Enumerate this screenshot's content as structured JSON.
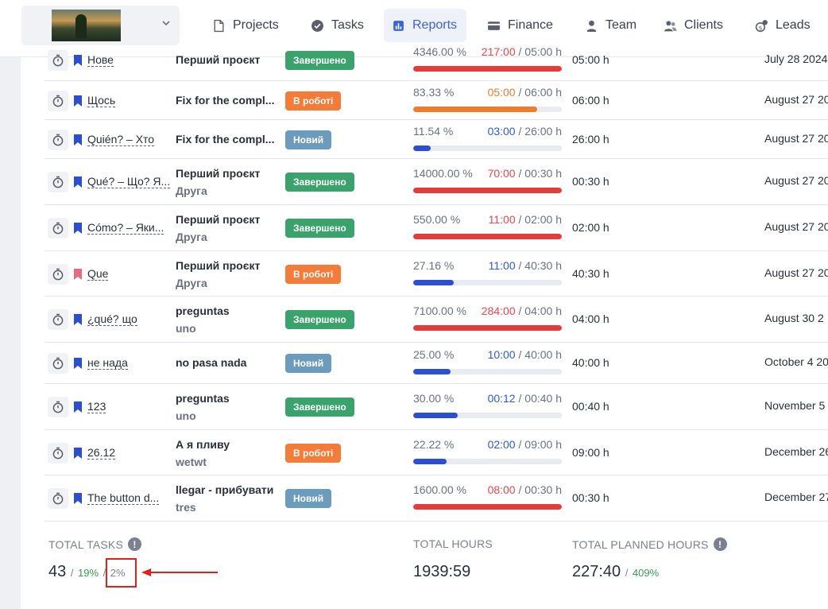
{
  "nav": {
    "items": [
      {
        "label": "Projects",
        "icon": "file-icon"
      },
      {
        "label": "Tasks",
        "icon": "check-circle-icon"
      },
      {
        "label": "Reports",
        "icon": "bar-chart-icon",
        "active": true
      },
      {
        "label": "Finance",
        "icon": "credit-card-icon"
      },
      {
        "label": "Team",
        "icon": "user-icon"
      },
      {
        "label": "Clients",
        "icon": "users-icon"
      },
      {
        "label": "Leads",
        "icon": "leads-icon"
      }
    ]
  },
  "colors": {
    "accent": "#3c63d8",
    "done": "#3aa36c",
    "in_work": "#f47b38",
    "new": "#6b9bbd",
    "over": "#e63b3b",
    "highlight": "#e0201c"
  },
  "rows": [
    {
      "name": "Нове",
      "bookmark": "blue",
      "project": "Перший проєкт",
      "client": "",
      "status": "Завершено",
      "status_type": "done",
      "pct": "4346.00 %",
      "spent": "217:00",
      "spent_color": "red",
      "of_planned": "/ 05:00 h",
      "progress": 1.0,
      "bar_color": "red",
      "planned": "05:00 h",
      "date": "July 28 2024"
    },
    {
      "name": "Щось",
      "bookmark": "blue",
      "project": "Fix for the compl...",
      "client": "",
      "status": "В роботі",
      "status_type": "work",
      "pct": "83.33 %",
      "spent": "05:00",
      "spent_color": "orange",
      "of_planned": "/ 06:00 h",
      "progress": 0.8333,
      "bar_color": "orange",
      "planned": "06:00 h",
      "date": "August 27 20"
    },
    {
      "name": "Quién? – Хто",
      "bookmark": "blue",
      "project": "Fix for the compl...",
      "client": "",
      "status": "Новий",
      "status_type": "new",
      "pct": "11.54 %",
      "spent": "03:00",
      "spent_color": "blue",
      "of_planned": "/ 26:00 h",
      "progress": 0.1154,
      "bar_color": "blue",
      "planned": "26:00 h",
      "date": "August 27 20"
    },
    {
      "name": "Qué? – Що? Я...",
      "bookmark": "blue",
      "project": "Перший проєкт",
      "client": "Друга",
      "status": "Завершено",
      "status_type": "done",
      "pct": "14000.00 %",
      "spent": "70:00",
      "spent_color": "red",
      "of_planned": "/ 00:30 h",
      "progress": 1.0,
      "bar_color": "red",
      "planned": "00:30 h",
      "date": "August 27 20"
    },
    {
      "name": "Cómo? – Яки...",
      "bookmark": "blue",
      "project": "Перший проєкт",
      "client": "Друга",
      "status": "Завершено",
      "status_type": "done",
      "pct": "550.00 %",
      "spent": "11:00",
      "spent_color": "red",
      "of_planned": "/ 02:00 h",
      "progress": 1.0,
      "bar_color": "red",
      "planned": "02:00 h",
      "date": "August 27 20"
    },
    {
      "name": "Que",
      "bookmark": "pink",
      "project": "Перший проєкт",
      "client": "Друга",
      "status": "В роботі",
      "status_type": "work",
      "pct": "27.16 %",
      "spent": "11:00",
      "spent_color": "blue",
      "of_planned": "/ 40:30 h",
      "progress": 0.2716,
      "bar_color": "blue",
      "planned": "40:30 h",
      "date": "August 27 20"
    },
    {
      "name": "¿qué? що",
      "bookmark": "blue",
      "project": "preguntas",
      "client": "uno",
      "status": "Завершено",
      "status_type": "done",
      "pct": "7100.00 %",
      "spent": "284:00",
      "spent_color": "red",
      "of_planned": "/ 04:00 h",
      "progress": 1.0,
      "bar_color": "red",
      "planned": "04:00 h",
      "date": "August 30 2"
    },
    {
      "name": "не нада",
      "bookmark": "blue",
      "project": "no pasa nada",
      "client": "",
      "status": "Новий",
      "status_type": "new",
      "pct": "25.00 %",
      "spent": "10:00",
      "spent_color": "blue",
      "of_planned": "/ 40:00 h",
      "progress": 0.25,
      "bar_color": "blue",
      "planned": "40:00 h",
      "date": "October 4 20"
    },
    {
      "name": "123",
      "bookmark": "blue",
      "project": "preguntas",
      "client": "uno",
      "status": "Завершено",
      "status_type": "done",
      "pct": "30.00 %",
      "spent": "00:12",
      "spent_color": "blue",
      "of_planned": "/ 00:40 h",
      "progress": 0.3,
      "bar_color": "blue",
      "planned": "00:40 h",
      "date": "November 5"
    },
    {
      "name": "26.12",
      "bookmark": "blue",
      "project": "А я пливу",
      "client": "wetwt",
      "status": "В роботі",
      "status_type": "work",
      "pct": "22.22 %",
      "spent": "02:00",
      "spent_color": "blue",
      "of_planned": "/ 09:00 h",
      "progress": 0.2222,
      "bar_color": "blue",
      "planned": "09:00 h",
      "date": "December 26"
    },
    {
      "name": "The button d...",
      "bookmark": "blue",
      "project": "llegar - прибувати",
      "client": "tres",
      "status": "Новий",
      "status_type": "new",
      "pct": "1600.00 %",
      "spent": "08:00",
      "spent_color": "red",
      "of_planned": "/ 00:30 h",
      "progress": 1.0,
      "bar_color": "red",
      "planned": "00:30 h",
      "date": "December 27"
    }
  ],
  "totals": {
    "tasks_label": "TOTAL TASKS",
    "tasks_value": "43",
    "tasks_sep1": "/",
    "tasks_pct1": "19%",
    "tasks_sep2": "/",
    "tasks_pct2": "2%",
    "hours_label": "TOTAL HOURS",
    "hours_value": "1939:59",
    "planned_label": "TOTAL PLANNED HOURS",
    "planned_value": "227:40",
    "planned_sep": "/",
    "planned_pct": "409%"
  }
}
